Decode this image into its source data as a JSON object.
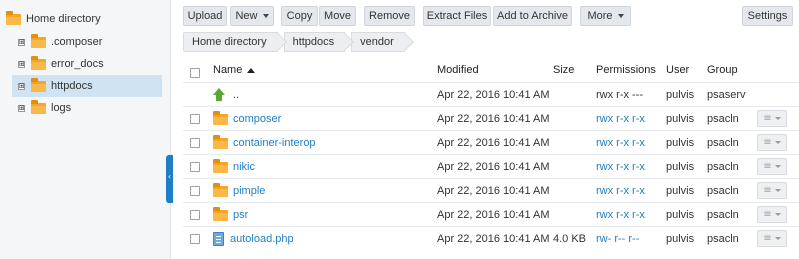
{
  "sidebar": {
    "root_label": "Home directory",
    "items": [
      {
        "label": ".composer",
        "selected": false
      },
      {
        "label": "error_docs",
        "selected": false
      },
      {
        "label": "httpdocs",
        "selected": true
      },
      {
        "label": "logs",
        "selected": false
      }
    ],
    "expander_symbol": "⊞"
  },
  "toolbar": {
    "upload": "Upload",
    "new": "New",
    "copy": "Copy",
    "move": "Move",
    "remove": "Remove",
    "extract": "Extract Files",
    "add_archive": "Add to Archive",
    "more": "More",
    "settings": "Settings"
  },
  "breadcrumb": [
    "Home directory",
    "httpdocs",
    "vendor"
  ],
  "table": {
    "headers": {
      "name": "Name",
      "modified": "Modified",
      "size": "Size",
      "permissions": "Permissions",
      "user": "User",
      "group": "Group"
    },
    "rows": [
      {
        "type": "up",
        "name": "..",
        "modified": "Apr 22, 2016 10:41 AM",
        "size": "",
        "permissions": "rwx r-x ---",
        "user": "pulvis",
        "group": "psaserv"
      },
      {
        "type": "folder",
        "name": "composer",
        "modified": "Apr 22, 2016 10:41 AM",
        "size": "",
        "permissions": "rwx r-x r-x",
        "user": "pulvis",
        "group": "psacln"
      },
      {
        "type": "folder",
        "name": "container-interop",
        "modified": "Apr 22, 2016 10:41 AM",
        "size": "",
        "permissions": "rwx r-x r-x",
        "user": "pulvis",
        "group": "psacln"
      },
      {
        "type": "folder",
        "name": "nikic",
        "modified": "Apr 22, 2016 10:41 AM",
        "size": "",
        "permissions": "rwx r-x r-x",
        "user": "pulvis",
        "group": "psacln"
      },
      {
        "type": "folder",
        "name": "pimple",
        "modified": "Apr 22, 2016 10:41 AM",
        "size": "",
        "permissions": "rwx r-x r-x",
        "user": "pulvis",
        "group": "psacln"
      },
      {
        "type": "folder",
        "name": "psr",
        "modified": "Apr 22, 2016 10:41 AM",
        "size": "",
        "permissions": "rwx r-x r-x",
        "user": "pulvis",
        "group": "psacln"
      },
      {
        "type": "file",
        "name": "autoload.php",
        "modified": "Apr 22, 2016 10:41 AM",
        "size": "4.0 KB",
        "permissions": "rw- r-- r--",
        "user": "pulvis",
        "group": "psacln"
      }
    ]
  },
  "colors": {
    "link": "#1f7fc4",
    "folder": "#f5a623",
    "selected_bg": "#cfe3f2",
    "up_arrow": "#5aa832"
  }
}
